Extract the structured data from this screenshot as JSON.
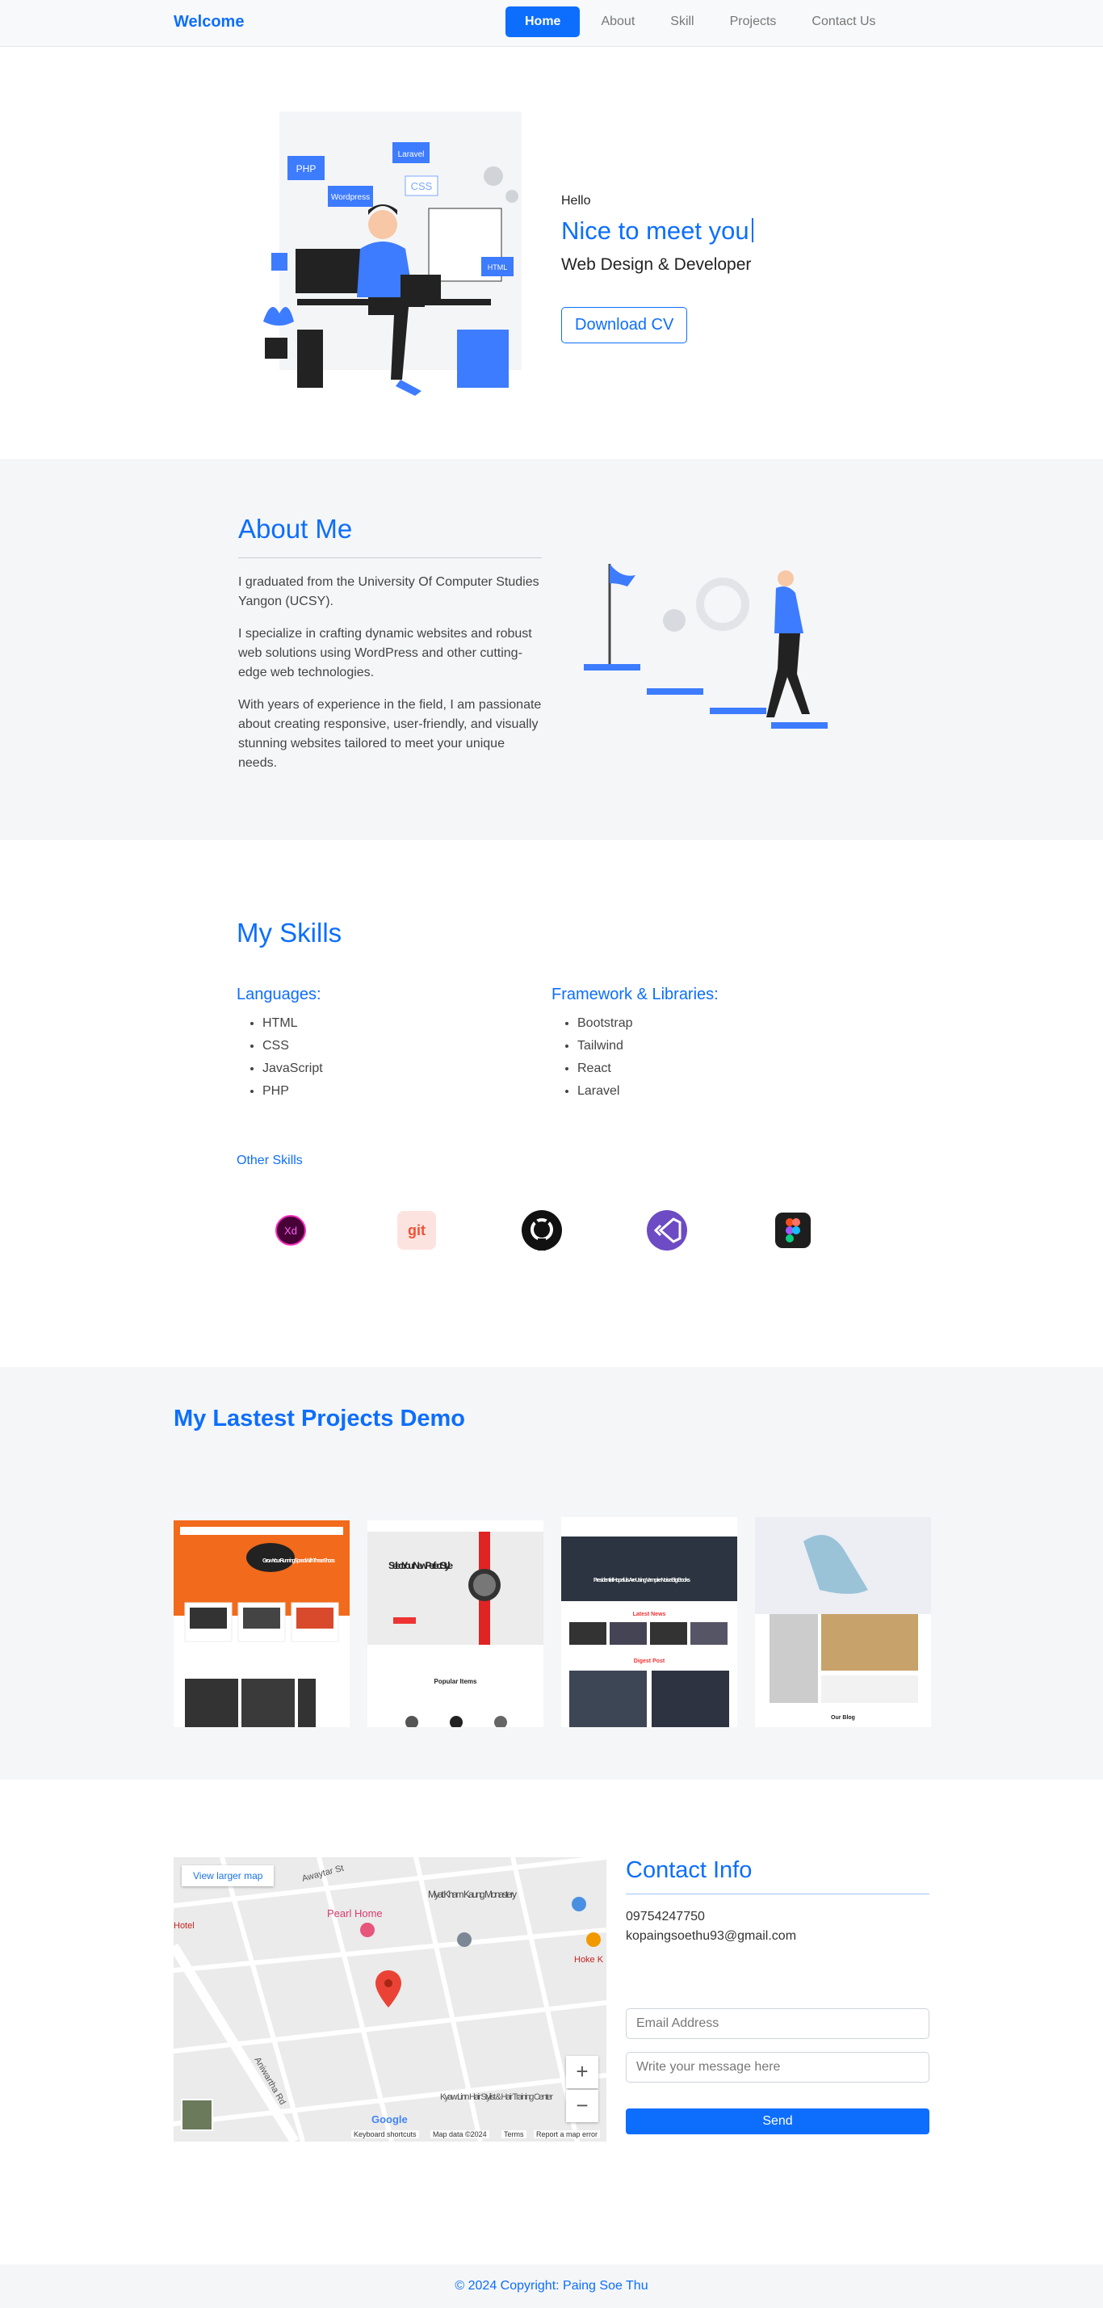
{
  "nav": {
    "brand": "Welcome",
    "links": [
      "Home",
      "About",
      "Skill",
      "Projects",
      "Contact Us"
    ]
  },
  "hero": {
    "greeting": "Hello",
    "title": "Nice to meet you",
    "subtitle": "Web Design & Developer",
    "cta": "Download CV",
    "illustration_labels": [
      "PHP",
      "Laravel",
      "CSS",
      "Wordpress",
      "HTML"
    ]
  },
  "about": {
    "title": "About Me",
    "paragraphs": [
      "I graduated from the University Of Computer Studies Yangon (UCSY).",
      "I specialize in crafting dynamic websites and robust web solutions using WordPress and other cutting-edge web technologies.",
      "With years of experience in the field, I am passionate about creating responsive, user-friendly, and visually stunning websites tailored to meet your unique needs."
    ]
  },
  "skills": {
    "title": "My Skills",
    "languages": {
      "heading": "Languages:",
      "items": [
        "HTML",
        "CSS",
        "JavaScript",
        "PHP"
      ]
    },
    "frameworks": {
      "heading": "Framework & Libraries:",
      "items": [
        "Bootstrap",
        "Tailwind",
        "React",
        "Laravel"
      ]
    },
    "other_heading": "Other Skills",
    "tools": [
      {
        "icon": "adobe-xd-icon",
        "label": "Xd"
      },
      {
        "icon": "git-icon",
        "label": "git"
      },
      {
        "icon": "github-icon",
        "label": ""
      },
      {
        "icon": "visual-studio-icon",
        "label": ""
      },
      {
        "icon": "figma-icon",
        "label": ""
      }
    ]
  },
  "projects": {
    "title": "My Lastest Projects Demo",
    "cards": [
      {
        "heading": "Grow Your Running Speed With These Shoes"
      },
      {
        "heading": "Select Your New Perfect Style",
        "section": "Popular Items"
      },
      {
        "heading": "Presidential Hopefuls Are Using Vampire Noise Big Books",
        "section1": "Latest News",
        "section2": "Digest Post"
      },
      {
        "heading": "Our Blog"
      }
    ]
  },
  "contact": {
    "map": {
      "larger_link": "View larger map",
      "places": [
        "Awaytar St",
        "Myat Kham Kaung Monastery",
        "Pearl Home",
        "Hoke K",
        "Kyaw Linn Hair Stylist & Hair Training Center",
        "Aniwartha Rd",
        "Hotel"
      ],
      "google": "Google",
      "footer": [
        "Keyboard shortcuts",
        "Map data ©2024",
        "Terms",
        "Report a map error"
      ]
    },
    "title": "Contact Info",
    "phone": "09754247750",
    "email": "kopaingsoethu93@gmail.com",
    "email_placeholder": "Email Address",
    "message_placeholder": "Write your message here",
    "send": "Send"
  },
  "footer": {
    "text": "© 2024 Copyright: Paing Soe Thu"
  },
  "colors": {
    "primary": "#0d6efd",
    "section_bg": "#f5f6f8"
  }
}
